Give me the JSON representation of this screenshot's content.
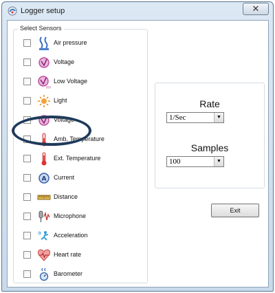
{
  "window": {
    "title": "Logger setup",
    "close_label": "✕"
  },
  "sensors_group": {
    "legend": "Select Sensors",
    "items": [
      {
        "label": "Air pressure",
        "checked": false,
        "icon": "air-pressure-icon"
      },
      {
        "label": "Voltage",
        "checked": false,
        "icon": "voltage-icon"
      },
      {
        "label": "Low Voltage",
        "checked": false,
        "icon": "low-voltage-icon"
      },
      {
        "label": "Light",
        "checked": false,
        "icon": "light-icon"
      },
      {
        "label": "Voltage",
        "checked": true,
        "icon": "voltage-icon"
      },
      {
        "label": "Amb. Temperature",
        "checked": false,
        "icon": "ambient-temperature-icon"
      },
      {
        "label": "Ext. Temperature",
        "checked": false,
        "icon": "external-temperature-icon"
      },
      {
        "label": "Current",
        "checked": false,
        "icon": "current-icon"
      },
      {
        "label": "Distance",
        "checked": false,
        "icon": "distance-icon"
      },
      {
        "label": "Microphone",
        "checked": false,
        "icon": "microphone-icon"
      },
      {
        "label": "Acceleration",
        "checked": false,
        "icon": "acceleration-icon"
      },
      {
        "label": "Heart rate",
        "checked": false,
        "icon": "heart-rate-icon"
      },
      {
        "label": "Barometer",
        "checked": false,
        "icon": "barometer-icon"
      }
    ]
  },
  "settings": {
    "rate_heading": "Rate",
    "rate_value": "1/Sec",
    "samples_heading": "Samples",
    "samples_value": "100"
  },
  "exit_label": "Exit",
  "colors": {
    "highlight_ellipse": "#1f3a5a",
    "window_frame": "#c9daea"
  }
}
